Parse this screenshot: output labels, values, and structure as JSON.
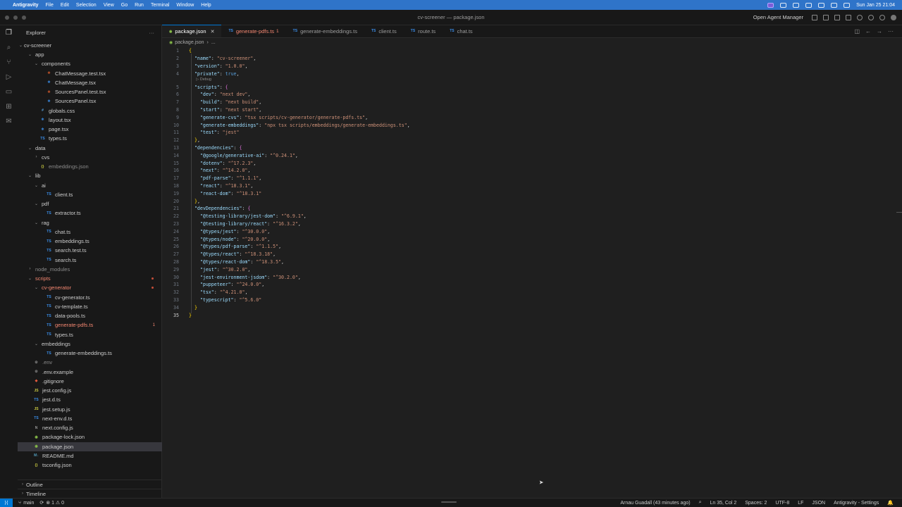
{
  "menubar": {
    "app_name": "Antigravity",
    "items": [
      "File",
      "Edit",
      "Selection",
      "View",
      "Go",
      "Run",
      "Terminal",
      "Window",
      "Help"
    ],
    "clock": "Sun Jan 25 21:04"
  },
  "window": {
    "title": "cv-screener — package.json",
    "agent_manager": "Open Agent Manager"
  },
  "sidebar": {
    "title": "Explorer",
    "root": "cv-screener",
    "tree": [
      {
        "label": "app",
        "depth": 1,
        "type": "folder",
        "open": true
      },
      {
        "label": "components",
        "depth": 2,
        "type": "folder",
        "open": true
      },
      {
        "label": "ChatMessage.test.tsx",
        "depth": 3,
        "type": "tsx"
      },
      {
        "label": "ChatMessage.tsx",
        "depth": 3,
        "type": "tsx-blue"
      },
      {
        "label": "SourcesPanel.test.tsx",
        "depth": 3,
        "type": "tsx"
      },
      {
        "label": "SourcesPanel.tsx",
        "depth": 3,
        "type": "tsx-blue"
      },
      {
        "label": "globals.css",
        "depth": 2,
        "type": "css"
      },
      {
        "label": "layout.tsx",
        "depth": 2,
        "type": "tsx-blue"
      },
      {
        "label": "page.tsx",
        "depth": 2,
        "type": "tsx-blue"
      },
      {
        "label": "types.ts",
        "depth": 2,
        "type": "ts"
      },
      {
        "label": "data",
        "depth": 1,
        "type": "folder",
        "open": true
      },
      {
        "label": "cvs",
        "depth": 2,
        "type": "folder",
        "open": false
      },
      {
        "label": "embeddings.json",
        "depth": 2,
        "type": "json",
        "dim": true
      },
      {
        "label": "lib",
        "depth": 1,
        "type": "folder",
        "open": true
      },
      {
        "label": "ai",
        "depth": 2,
        "type": "folder",
        "open": true
      },
      {
        "label": "client.ts",
        "depth": 3,
        "type": "ts"
      },
      {
        "label": "pdf",
        "depth": 2,
        "type": "folder",
        "open": true
      },
      {
        "label": "extractor.ts",
        "depth": 3,
        "type": "ts"
      },
      {
        "label": "rag",
        "depth": 2,
        "type": "folder",
        "open": true
      },
      {
        "label": "chat.ts",
        "depth": 3,
        "type": "ts"
      },
      {
        "label": "embeddings.ts",
        "depth": 3,
        "type": "ts"
      },
      {
        "label": "search.test.ts",
        "depth": 3,
        "type": "ts"
      },
      {
        "label": "search.ts",
        "depth": 3,
        "type": "ts"
      },
      {
        "label": "node_modules",
        "depth": 1,
        "type": "folder",
        "open": false,
        "dim": true
      },
      {
        "label": "scripts",
        "depth": 1,
        "type": "folder",
        "open": true,
        "err": true,
        "dot": true
      },
      {
        "label": "cv-generator",
        "depth": 2,
        "type": "folder",
        "open": true,
        "err": true,
        "dot": true
      },
      {
        "label": "cv-generator.ts",
        "depth": 3,
        "type": "ts"
      },
      {
        "label": "cv-template.ts",
        "depth": 3,
        "type": "ts"
      },
      {
        "label": "data-pools.ts",
        "depth": 3,
        "type": "ts"
      },
      {
        "label": "generate-pdfs.ts",
        "depth": 3,
        "type": "ts",
        "err": true,
        "badge": "1"
      },
      {
        "label": "types.ts",
        "depth": 3,
        "type": "ts"
      },
      {
        "label": "embeddings",
        "depth": 2,
        "type": "folder",
        "open": true
      },
      {
        "label": "generate-embeddings.ts",
        "depth": 3,
        "type": "ts"
      },
      {
        "label": ".env",
        "depth": 1,
        "type": "gear",
        "dim": true
      },
      {
        "label": ".env.example",
        "depth": 1,
        "type": "gear"
      },
      {
        "label": ".gitignore",
        "depth": 1,
        "type": "git"
      },
      {
        "label": "jest.config.js",
        "depth": 1,
        "type": "js"
      },
      {
        "label": "jest.d.ts",
        "depth": 1,
        "type": "ts"
      },
      {
        "label": "jest.setup.js",
        "depth": 1,
        "type": "js"
      },
      {
        "label": "next-env.d.ts",
        "depth": 1,
        "type": "ts"
      },
      {
        "label": "next.config.js",
        "depth": 1,
        "type": "next"
      },
      {
        "label": "package-lock.json",
        "depth": 1,
        "type": "npm"
      },
      {
        "label": "package.json",
        "depth": 1,
        "type": "npm",
        "selected": true
      },
      {
        "label": "README.md",
        "depth": 1,
        "type": "md"
      },
      {
        "label": "tsconfig.json",
        "depth": 1,
        "type": "json"
      }
    ],
    "outline": "Outline",
    "timeline": "Timeline"
  },
  "tabs": [
    {
      "label": "package.json",
      "active": true
    },
    {
      "label": "generate-pdfs.ts",
      "err": true,
      "count": "1"
    },
    {
      "label": "generate-embeddings.ts"
    },
    {
      "label": "client.ts"
    },
    {
      "label": "route.ts"
    },
    {
      "label": "chat.ts"
    }
  ],
  "breadcrumb": [
    "package.json",
    "..."
  ],
  "codelens": "▷ Debug",
  "code": [
    "{",
    "  \"name\": \"cv-screener\",",
    "  \"version\": \"1.0.0\",",
    "  \"private\": true,",
    "  \"scripts\": {",
    "    \"dev\": \"next dev\",",
    "    \"build\": \"next build\",",
    "    \"start\": \"next start\",",
    "    \"generate-cvs\": \"tsx scripts/cv-generator/generate-pdfs.ts\",",
    "    \"generate-embeddings\": \"npx tsx scripts/embeddings/generate-embeddings.ts\",",
    "    \"test\": \"jest\"",
    "  },",
    "  \"dependencies\": {",
    "    \"@google/generative-ai\": \"^0.24.1\",",
    "    \"dotenv\": \"^17.2.3\",",
    "    \"next\": \"^14.2.0\",",
    "    \"pdf-parse\": \"^1.1.1\",",
    "    \"react\": \"^18.3.1\",",
    "    \"react-dom\": \"^18.3.1\"",
    "  },",
    "  \"devDependencies\": {",
    "    \"@testing-library/jest-dom\": \"^6.9.1\",",
    "    \"@testing-library/react\": \"^16.3.2\",",
    "    \"@types/jest\": \"^30.0.0\",",
    "    \"@types/node\": \"^20.0.0\",",
    "    \"@types/pdf-parse\": \"^1.1.5\",",
    "    \"@types/react\": \"^18.3.18\",",
    "    \"@types/react-dom\": \"^18.3.5\",",
    "    \"jest\": \"^30.2.0\",",
    "    \"jest-environment-jsdom\": \"^30.2.0\",",
    "    \"puppeteer\": \"^24.0.0\",",
    "    \"tsx\": \"^4.21.0\",",
    "    \"typescript\": \"^5.6.0\"",
    "  }",
    "}"
  ],
  "statusbar": {
    "branch": "main",
    "problems": "⊗ 1 ⚠ 0",
    "blame": "Arnau Guadall (43 minutes ago)",
    "position": "Ln 35, Col 2",
    "spaces": "Spaces: 2",
    "encoding": "UTF-8",
    "eol": "LF",
    "language": "JSON",
    "settings": "Antigravity - Settings"
  },
  "colors": {
    "accent": "#0078d4",
    "menubar": "#2f74c9",
    "error": "#f48771"
  }
}
